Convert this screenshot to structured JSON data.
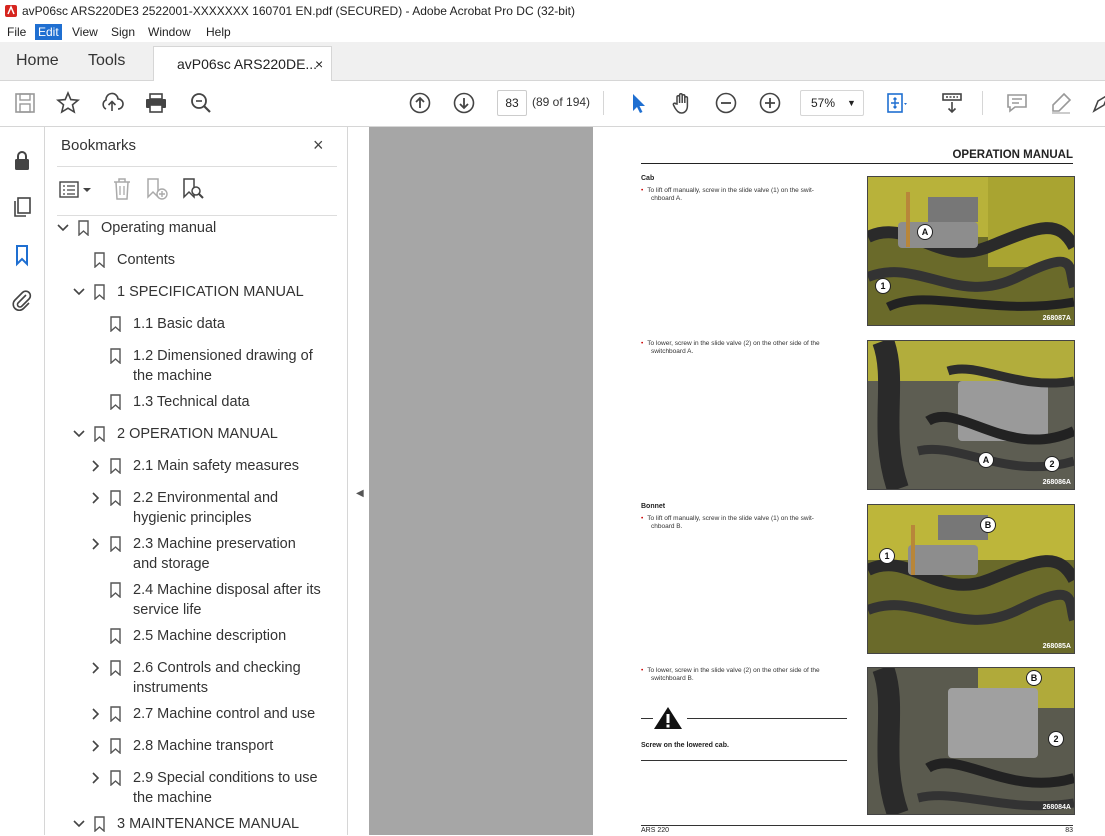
{
  "window": {
    "title": "avP06sc ARS220DE3 2522001-XXXXXXX 160701 EN.pdf (SECURED) - Adobe Acrobat Pro DC (32-bit)"
  },
  "menu": [
    "File",
    "Edit",
    "View",
    "Sign",
    "Window",
    "Help"
  ],
  "tabs": {
    "home": "Home",
    "tools": "Tools",
    "document": "avP06sc ARS220DE...",
    "close": "×"
  },
  "toolbar": {
    "page_number": "83",
    "page_count": "(89 of 194)",
    "zoom": "57%"
  },
  "bookmarks": {
    "title": "Bookmarks",
    "close": "×",
    "items": [
      {
        "label": "Operating manual",
        "expanded": true
      },
      {
        "label": "Contents"
      },
      {
        "label": "1 SPECIFICATION MANUAL",
        "expanded": true
      },
      {
        "label": "1.1 Basic data"
      },
      {
        "label": "1.2 Dimensioned drawing of",
        "label2": "the machine"
      },
      {
        "label": "1.3 Technical data"
      },
      {
        "label": "2 OPERATION MANUAL",
        "expanded": true
      },
      {
        "label": "2.1 Main safety measures"
      },
      {
        "label": "2.2 Environmental and",
        "label2": "hygienic principles"
      },
      {
        "label": "2.3 Machine preservation",
        "label2": "and storage"
      },
      {
        "label": "2.4 Machine disposal after its",
        "label2": "service life"
      },
      {
        "label": "2.5 Machine description"
      },
      {
        "label": "2.6 Controls and checking",
        "label2": "instruments"
      },
      {
        "label": "2.7 Machine control and use"
      },
      {
        "label": "2.8 Machine transport"
      },
      {
        "label": "2.9 Special conditions to use",
        "label2": "the machine"
      },
      {
        "label": "3 MAINTENANCE MANUAL",
        "expanded": true
      }
    ]
  },
  "document_page": {
    "header": "OPERATION MANUAL",
    "section_cab": "Cab",
    "section_bonnet": "Bonnet",
    "bullets": [
      {
        "line1": "To lift off manually, screw in the slide valve (1) on the swit-",
        "line2": "chboard A."
      },
      {
        "line1": "To lower, screw in the slide valve (2) on the other side of the",
        "line2": "switchboard A."
      },
      {
        "line1": "To lift off manually, screw in the slide valve (1) on the swit-",
        "line2": "chboard B."
      },
      {
        "line1": "To lower, screw in the slide valve (2) on the other side of the",
        "line2": "switchboard B."
      }
    ],
    "photos": [
      {
        "code": "268087A",
        "callouts": [
          "A",
          "1"
        ]
      },
      {
        "code": "268086A",
        "callouts": [
          "A",
          "2"
        ]
      },
      {
        "code": "268085A",
        "callouts": [
          "B",
          "1"
        ]
      },
      {
        "code": "268084A",
        "callouts": [
          "B",
          "2"
        ]
      }
    ],
    "warning": "Screw on the lowered cab.",
    "footer_left": "ARS 220",
    "footer_right": "83"
  }
}
